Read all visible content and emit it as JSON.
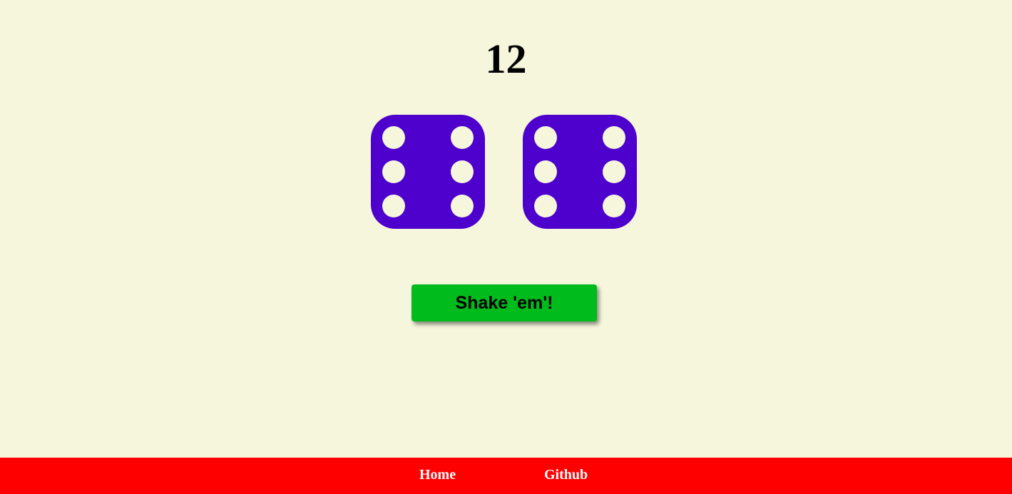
{
  "total": "12",
  "dice": [
    {
      "value": 6,
      "icon": "die-six-icon"
    },
    {
      "value": 6,
      "icon": "die-six-icon"
    }
  ],
  "shake_button": {
    "label": "Shake 'em'!"
  },
  "footer": {
    "links": [
      {
        "label": "Home"
      },
      {
        "label": "Github"
      }
    ]
  },
  "colors": {
    "background": "#f5f6dc",
    "die": "#4e00cc",
    "pip": "#f5f6dc",
    "button": "#00bb1c",
    "footer": "#ff0000",
    "footer_text": "#ffffff"
  }
}
